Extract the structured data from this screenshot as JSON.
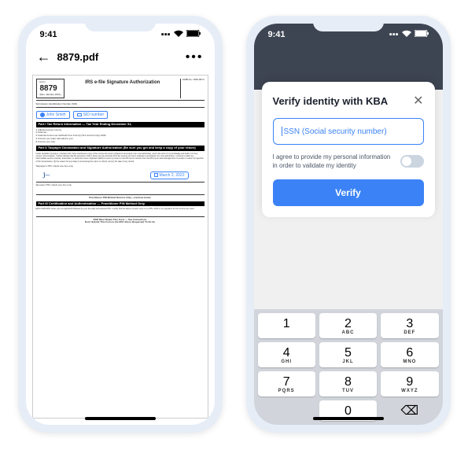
{
  "status": {
    "time": "9:41"
  },
  "phone1": {
    "header": {
      "title": "8879.pdf"
    },
    "form": {
      "number": "8879",
      "title": "IRS e-file Signature Authorization",
      "name_field": "John Smith",
      "sid_field": "SID number",
      "part1": "Part I    Tax Return Information — Tax Year Ending December 31,",
      "part2": "Part II    Taxpayer Declaration and Signature Authorization (Be sure you get and keep a copy of your return)",
      "part3": "Part III    Certification and Authentication — Practitioner PIN Method Only",
      "date_value": "March 2, 2022",
      "footer1": "ERO Must Retain This Form — See Instructions",
      "footer2": "Don't Submit This Form to the IRS Unless Requested To Do So"
    }
  },
  "phone2": {
    "modal": {
      "title": "Verify identity with KBA",
      "ssn_placeholder": "SSN (Social security number)",
      "consent": "I agree to provide my personal information in order to validate my identity",
      "verify_label": "Verify"
    },
    "keypad": {
      "keys": [
        {
          "num": "1",
          "letters": ""
        },
        {
          "num": "2",
          "letters": "ABC"
        },
        {
          "num": "3",
          "letters": "DEF"
        },
        {
          "num": "4",
          "letters": "GHI"
        },
        {
          "num": "5",
          "letters": "JKL"
        },
        {
          "num": "6",
          "letters": "MNO"
        },
        {
          "num": "7",
          "letters": "PQRS"
        },
        {
          "num": "8",
          "letters": "TUV"
        },
        {
          "num": "9",
          "letters": "WXYZ"
        },
        {
          "num": "",
          "letters": ""
        },
        {
          "num": "0",
          "letters": ""
        },
        {
          "num": "⌫",
          "letters": ""
        }
      ]
    }
  }
}
